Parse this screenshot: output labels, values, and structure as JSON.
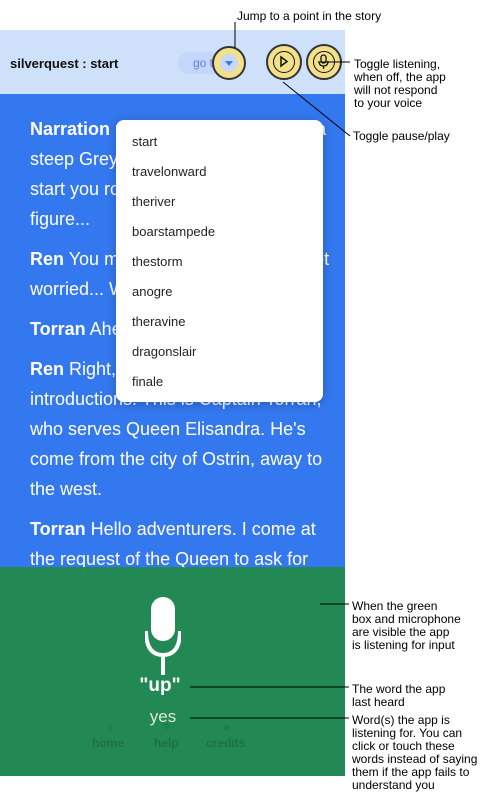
{
  "header": {
    "title": "silverquest : start",
    "go_label": "go to"
  },
  "story": [
    {
      "speaker": "Narration",
      "text": " road through the base of a steep Greyspire your friend ready to start you round see Ren and another figure..."
    },
    {
      "speaker": "Ren",
      "text": " You made it! I was starting to get worried... We have a job to do..."
    },
    {
      "speaker": "Torran",
      "text": " Ahem."
    },
    {
      "speaker": "Ren",
      "text": " Right, I should make introductions. This is Captain Torran, who serves Queen Elisandra. He's come from the city of Ostrin, away to the west."
    },
    {
      "speaker": "Torran",
      "text": " Hello adventurers. I come at the request of the Queen to ask for"
    }
  ],
  "dropdown": {
    "items": [
      "start",
      "travelonward",
      "theriver",
      "boarstampede",
      "thestorm",
      "anogre",
      "theravine",
      "dragonslair",
      "finale"
    ]
  },
  "listening": {
    "heard": "\"up\"",
    "listening_for": "yes"
  },
  "nav": {
    "home": "home",
    "help": "help",
    "credits": "credits"
  },
  "annotations": {
    "jump": "Jump to a point in the story",
    "toggle_listening": [
      "Toggle listening,",
      "when off, the app",
      "will not respond",
      "to your voice"
    ],
    "toggle_pause": "Toggle pause/play",
    "green_box": [
      "When the green",
      "box and microphone",
      "are visible the app",
      "is listening for input"
    ],
    "heard": [
      "The word the app",
      "last heard"
    ],
    "words": [
      "Word(s) the app is",
      "listening for. You can",
      "click or touch these",
      "words instead of saying",
      "them if the app fails to",
      "understand you"
    ]
  },
  "colors": {
    "header_bg": "#cfe0fb",
    "story_bg": "#3478f0",
    "highlight": "#f3e08a",
    "listening_green": "#228b46"
  }
}
